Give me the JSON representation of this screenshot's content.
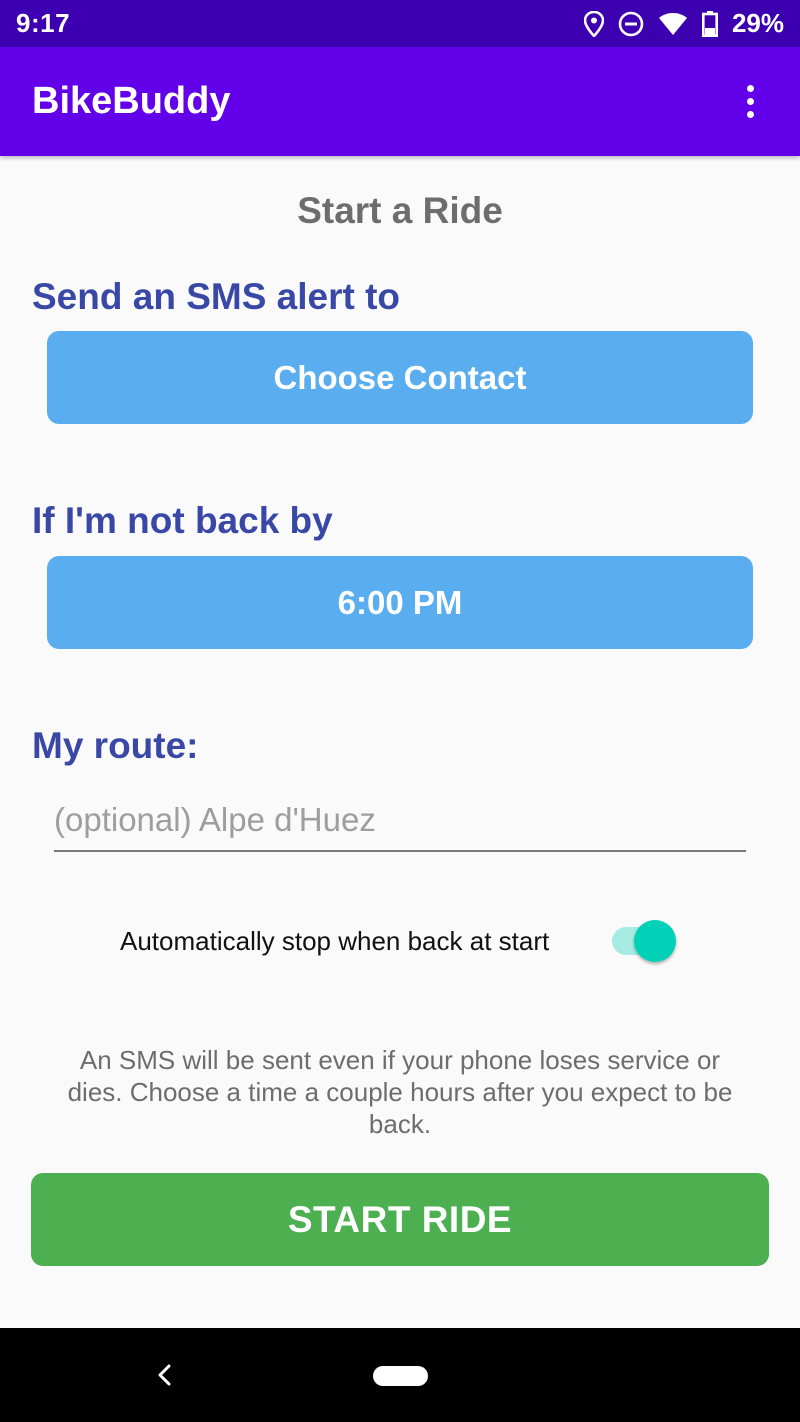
{
  "status_bar": {
    "time": "9:17",
    "battery": "29%",
    "icons": [
      "location-icon",
      "do-not-disturb-icon",
      "wifi-icon",
      "battery-icon"
    ]
  },
  "app_bar": {
    "title": "BikeBuddy",
    "menu_icon": "overflow-menu-icon"
  },
  "page": {
    "heading": "Start a Ride",
    "sms_label": "Send an SMS alert to",
    "contact_button": "Choose Contact",
    "time_label": "If I'm not back by",
    "time_button": "6:00 PM",
    "route_label": "My route:",
    "route_placeholder": "(optional) Alpe d'Huez",
    "route_value": "",
    "auto_stop_label": "Automatically stop when back at start",
    "auto_stop_enabled": true,
    "info": "An SMS will be sent even if your phone loses service or dies. Choose a time a couple hours after you expect to be back.",
    "start_button": "START RIDE"
  },
  "colors": {
    "status_bar": "#3d00b0",
    "app_bar": "#6200ea",
    "section_label": "#3948a6",
    "blue_button": "#5aaeef",
    "start_button": "#4caf50",
    "switch_thumb": "#00d1b7"
  }
}
